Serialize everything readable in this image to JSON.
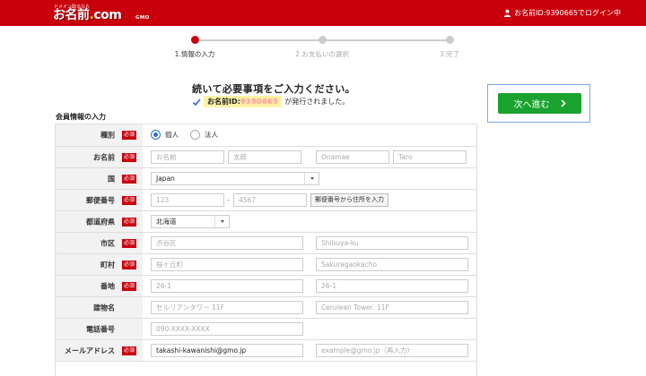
{
  "header": {
    "logo_tagline": "ドメイン取るなら",
    "logo_text_a": "お名前",
    "logo_text_dot": ".",
    "logo_text_b": "com",
    "logo_gmo": "GMO",
    "login_text": "お名前ID:9390665でログイン中",
    "user_icon": "user-icon"
  },
  "stepper": {
    "steps": [
      {
        "label": "1.情報の入力",
        "active": true
      },
      {
        "label": "2.お支払いの選択",
        "active": false
      },
      {
        "label": "3.完了",
        "active": false
      }
    ],
    "active_color": "#c8000b"
  },
  "notice": {
    "heading": "続いて必要事項をご入力ください。",
    "id_label": "お名前ID:",
    "id_value": "9390665",
    "issued_text": "が発行されました。",
    "check_icon": "check-icon"
  },
  "next_button": {
    "label": "次へ進む",
    "color": "#1aa22e"
  },
  "section_title": "会員情報の入力",
  "required_badge": "必須",
  "form": {
    "type": {
      "label": "種別",
      "options": [
        {
          "label": "個人",
          "selected": true
        },
        {
          "label": "法人",
          "selected": false
        }
      ]
    },
    "name": {
      "label": "お名前",
      "last_kanji_ph": "お名前",
      "first_kanji_ph": "太郎",
      "last_roman_ph": "Onamae",
      "first_roman_ph": "Taro"
    },
    "country": {
      "label": "国",
      "value": "Japan"
    },
    "postal": {
      "label": "郵便番号",
      "part1_ph": "123",
      "separator": "-",
      "part2_ph": "4567",
      "lookup_button": "郵便番号から住所を入力"
    },
    "prefecture": {
      "label": "都道府県",
      "value": "北海道"
    },
    "city": {
      "label": "市区",
      "jp_ph": "渋谷区",
      "en_ph": "Shibuya-ku"
    },
    "town": {
      "label": "町村",
      "jp_ph": "桜ヶ丘町",
      "en_ph": "Sakuragaokacho"
    },
    "address": {
      "label": "番地",
      "jp_ph": "26-1",
      "en_ph": "26-1"
    },
    "building": {
      "label": "建物名",
      "jp_ph": "セルリアンタワー 11F",
      "en_ph": "Cerulean Tower. 11F"
    },
    "phone": {
      "label": "電話番号",
      "ph": "090-XXXX-XXXX"
    },
    "email": {
      "label": "メールアドレス",
      "value": "takashi-kawanishi@gmo.jp",
      "confirm_ph": "example@gmo.jp（再入力）"
    }
  }
}
